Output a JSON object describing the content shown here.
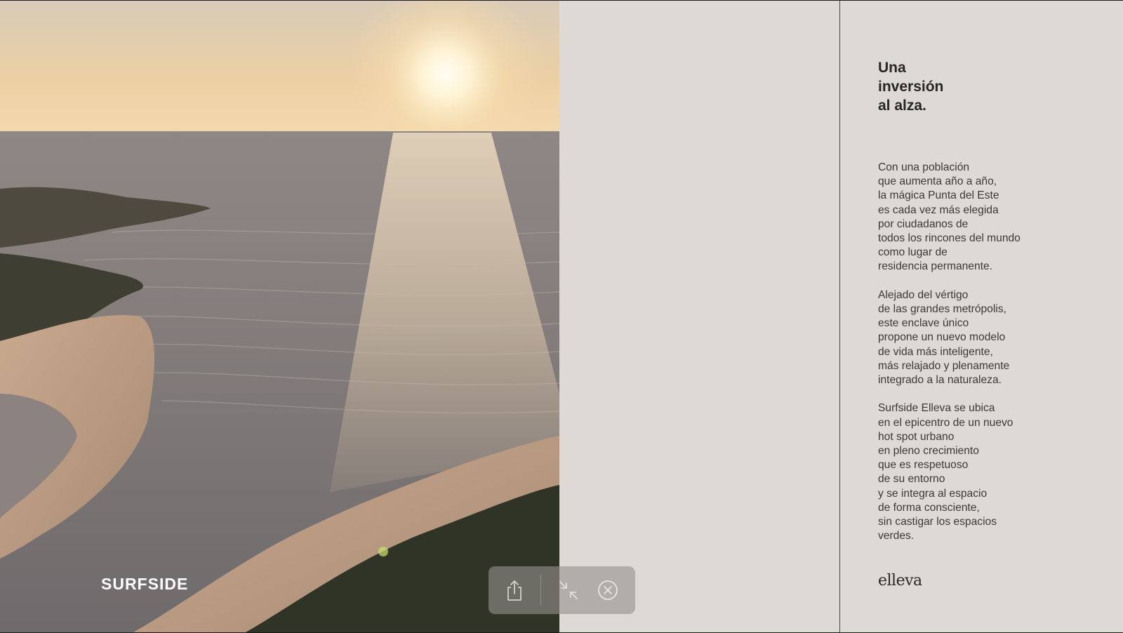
{
  "photo": {
    "brand_label": "SURFSIDE"
  },
  "content": {
    "heading_lines": [
      "Una",
      "inversión",
      "al alza."
    ],
    "paragraphs": [
      {
        "lines": [
          "Con una población",
          "que aumenta año a año,",
          "la mágica Punta del Este",
          "es cada vez más elegida",
          "por ciudadanos de",
          "todos los rincones del mundo",
          "como lugar de",
          "residencia permanente."
        ]
      },
      {
        "lines": [
          "Alejado del vértigo",
          "de las grandes metrópolis,",
          "este enclave único",
          "propone un nuevo modelo",
          "de vida más inteligente,",
          "más relajado y plenamente",
          "integrado a la naturaleza."
        ]
      },
      {
        "lines": [
          "Surfside Elleva se ubica",
          "en el epicentro de un nuevo",
          "hot spot urbano",
          "en pleno crecimiento",
          "que es respetuoso",
          "de su entorno",
          "y se integra al espacio",
          "de forma consciente,",
          "sin castigar los espacios",
          "verdes."
        ]
      }
    ],
    "logo_text": "elleva"
  },
  "toolbar": {
    "icons": [
      "share-icon",
      "shrink-icon",
      "close-icon"
    ]
  },
  "colors": {
    "panel_bg": "#dddad5",
    "text_dark": "#262624",
    "toolbar_bg": "rgba(150,146,140,0.62)"
  }
}
